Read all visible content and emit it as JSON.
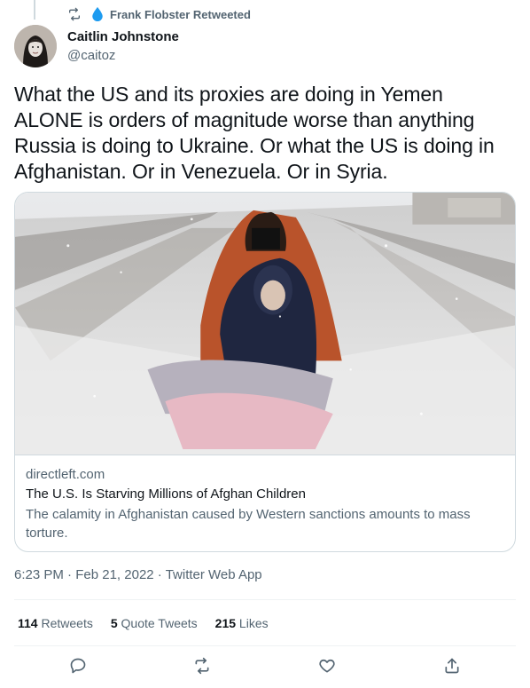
{
  "retweet_context": {
    "label": "Frank Flobster Retweeted",
    "icon": "retweet-icon"
  },
  "author": {
    "name": "Caitlin Johnstone",
    "handle": "@caitoz"
  },
  "tweet": {
    "text": "What the US and its proxies are doing in Yemen ALONE is orders of magnitude worse than anything Russia is doing to Ukraine. Or what the US is doing in Afghanistan. Or in Venezuela. Or in Syria."
  },
  "card": {
    "domain": "directleft.com",
    "title": "The U.S. Is Starving Millions of Afghan Children",
    "description": "The calamity in Afghanistan caused by Western sanctions amounts to mass torture."
  },
  "meta": {
    "time": "6:23 PM",
    "sep1": " · ",
    "date": "Feb 21, 2022",
    "sep2": " · ",
    "app": "Twitter Web App"
  },
  "stats": {
    "retweets_count": "114",
    "retweets_label": "Retweets",
    "quotes_count": "5",
    "quotes_label": "Quote Tweets",
    "likes_count": "215",
    "likes_label": "Likes"
  },
  "actions": {
    "reply_icon": "reply-icon",
    "retweet_icon": "retweet-icon",
    "like_icon": "heart-icon",
    "share_icon": "share-icon"
  },
  "colors": {
    "text_primary": "#0f1419",
    "text_secondary": "#536471",
    "border": "#cfd9de",
    "divider": "#eff3f4",
    "drop_blue": "#1d9bf0"
  }
}
